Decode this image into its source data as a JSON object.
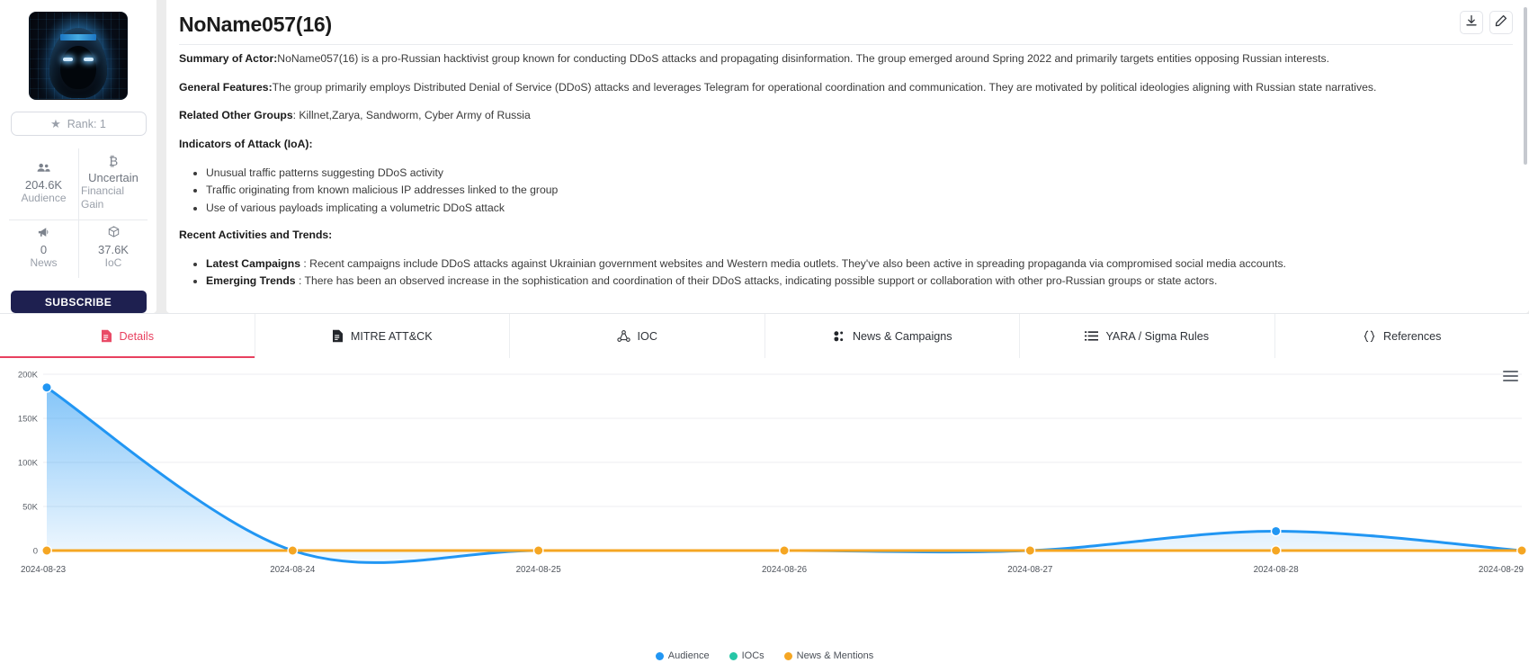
{
  "sidebar": {
    "avatar_alt": "hooded-hacker-avatar",
    "rank_label": "Rank: 1",
    "stats": [
      {
        "icon": "people-icon",
        "value": "204.6K",
        "label": "Audience"
      },
      {
        "icon": "bitcoin-icon",
        "value": "Uncertain",
        "label": "Financial Gain"
      },
      {
        "icon": "megaphone-icon",
        "value": "0",
        "label": "News"
      },
      {
        "icon": "package-icon",
        "value": "37.6K",
        "label": "IoC"
      }
    ],
    "subscribe_label": "SUBSCRIBE"
  },
  "header": {
    "title": "NoName057(16)",
    "download_icon": "download-icon",
    "edit_icon": "pencil-edit-icon"
  },
  "details": {
    "summary_label": "Summary of Actor:",
    "summary_text": "NoName057(16) is a pro-Russian hacktivist group known for conducting DDoS attacks and propagating disinformation. The group emerged around Spring 2022 and primarily targets entities opposing Russian interests.",
    "features_label": "General Features:",
    "features_text": "The group primarily employs Distributed Denial of Service (DDoS) attacks and leverages Telegram for operational coordination and communication. They are motivated by political ideologies aligning with Russian state narratives.",
    "related_label": "Related Other Groups",
    "related_text": ": Killnet,Zarya, Sandworm, Cyber Army of Russia",
    "ioa_heading": "Indicators of Attack (IoA):",
    "ioa_items": [
      "Unusual traffic patterns suggesting DDoS activity",
      "Traffic originating from known malicious IP addresses linked to the group",
      "Use of various payloads implicating a volumetric DDoS attack"
    ],
    "recent_heading": "Recent Activities and Trends:",
    "recent_items": [
      {
        "label": "Latest Campaigns",
        "text": " : Recent campaigns include DDoS attacks against Ukrainian government websites and Western media outlets. They've also been active in spreading propaganda via compromised social media accounts."
      },
      {
        "label": "Emerging Trends",
        "text": " : There has been an observed increase in the sophistication and coordination of their DDoS attacks, indicating possible support or collaboration with other pro-Russian groups or state actors."
      }
    ]
  },
  "tabs": [
    {
      "label": "Details",
      "icon": "document-red-icon",
      "active": true
    },
    {
      "label": "MITRE ATT&CK",
      "icon": "document-icon",
      "active": false
    },
    {
      "label": "IOC",
      "icon": "share-nodes-icon",
      "active": false
    },
    {
      "label": "News & Campaigns",
      "icon": "bubbles-icon",
      "active": false
    },
    {
      "label": "YARA / Sigma Rules",
      "icon": "list-icon",
      "active": false
    },
    {
      "label": "References",
      "icon": "braces-icon",
      "active": false
    }
  ],
  "chart_menu_icon": "hamburger-menu-icon",
  "chart_data": {
    "type": "area",
    "title": "",
    "xlabel": "",
    "ylabel": "",
    "x": [
      "2024-08-23",
      "2024-08-24",
      "2024-08-25",
      "2024-08-26",
      "2024-08-27",
      "2024-08-28",
      "2024-08-29"
    ],
    "yticks": [
      "0",
      "50K",
      "100K",
      "150K",
      "200K"
    ],
    "ytick_values": [
      0,
      50000,
      100000,
      150000,
      200000
    ],
    "ylim": [
      0,
      200000
    ],
    "grid": true,
    "legend_position": "bottom",
    "series": [
      {
        "name": "Audience",
        "color": "#2196f3",
        "values": [
          185000,
          0,
          0,
          0,
          0,
          22000,
          0
        ]
      },
      {
        "name": "IOCs",
        "color": "#26c6a6",
        "values": [
          0,
          0,
          0,
          0,
          0,
          0,
          0
        ]
      },
      {
        "name": "News & Mentions",
        "color": "#f5a623",
        "values": [
          0,
          0,
          0,
          0,
          0,
          0,
          0
        ]
      }
    ]
  }
}
